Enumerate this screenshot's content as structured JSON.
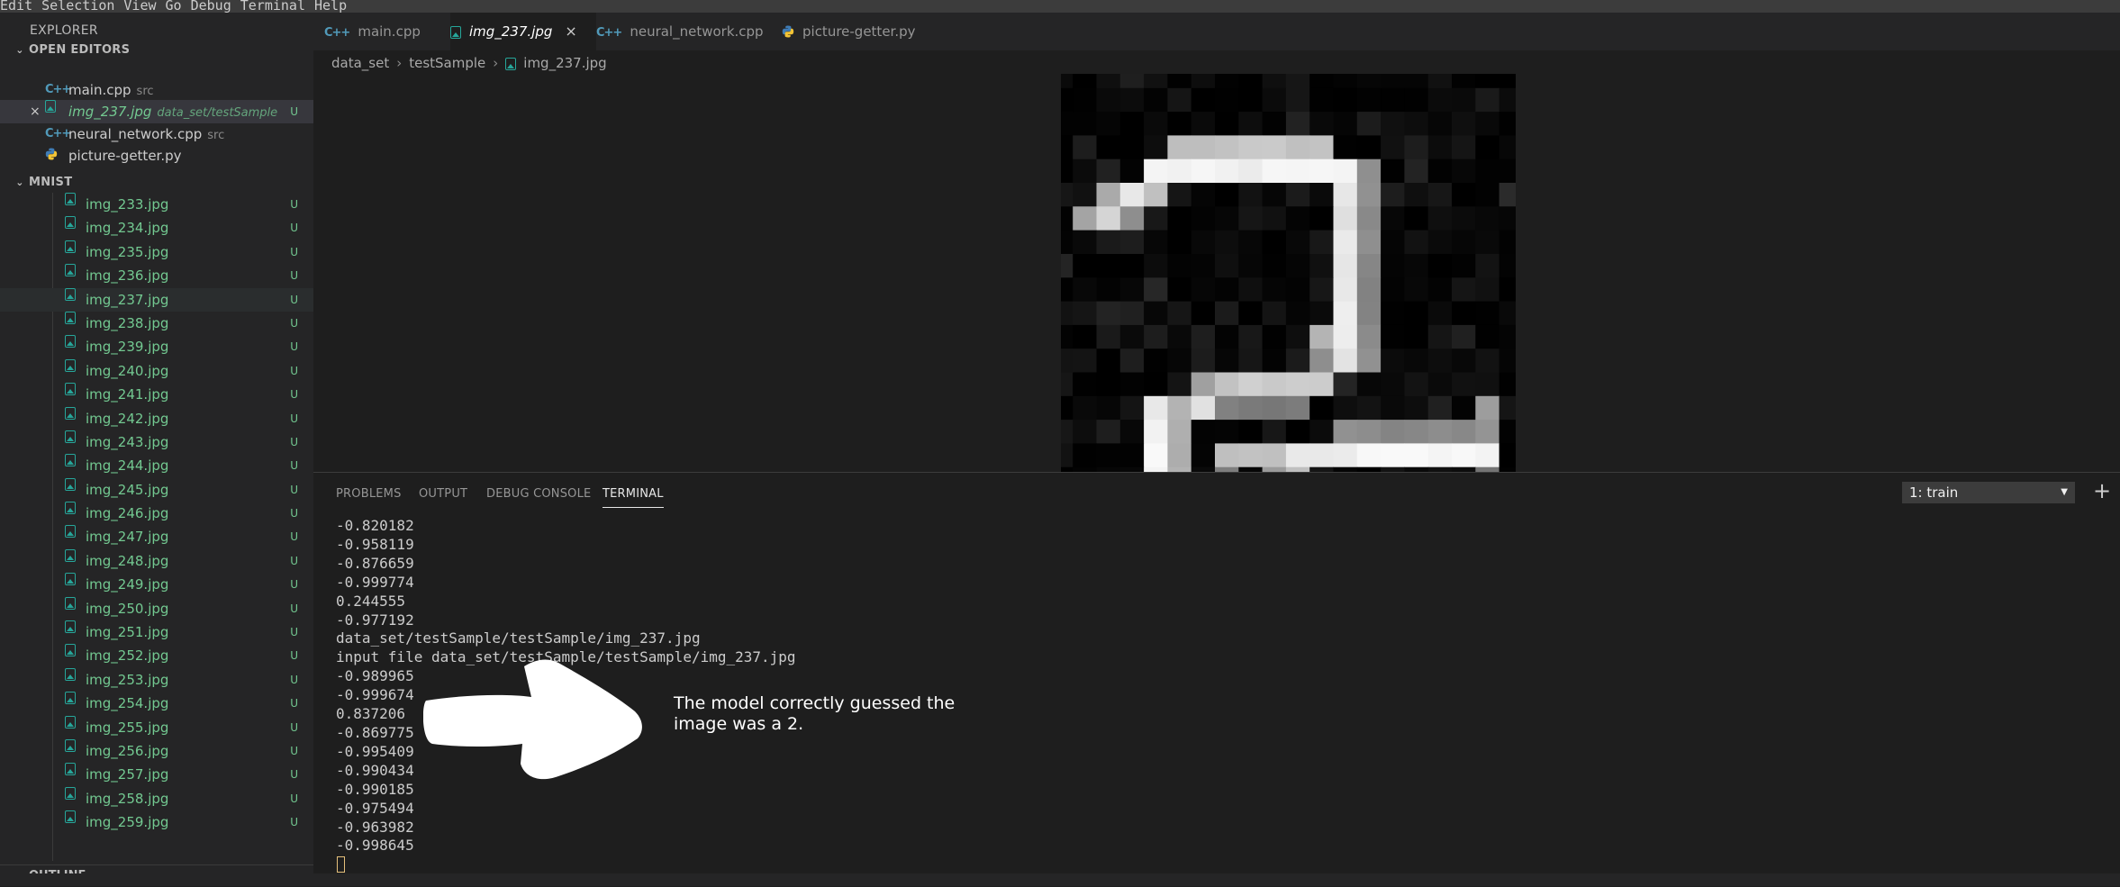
{
  "menubar": [
    "Edit",
    "Selection",
    "View",
    "Go",
    "Debug",
    "Terminal",
    "Help"
  ],
  "sidebar": {
    "title": "EXPLORER",
    "open_editors": {
      "header": "OPEN EDITORS",
      "items": [
        {
          "name": "main.cpp",
          "desc": "src",
          "type": "cpp"
        },
        {
          "name": "img_237.jpg",
          "desc": "data_set/testSample",
          "type": "img",
          "badge": "U",
          "close": "×"
        },
        {
          "name": "neural_network.cpp",
          "desc": "src",
          "type": "cpp"
        },
        {
          "name": "picture-getter.py",
          "desc": "",
          "type": "py"
        }
      ]
    },
    "folder": {
      "header": "MNIST",
      "files": [
        {
          "name": "img_233.jpg",
          "badge": "U"
        },
        {
          "name": "img_234.jpg",
          "badge": "U"
        },
        {
          "name": "img_235.jpg",
          "badge": "U"
        },
        {
          "name": "img_236.jpg",
          "badge": "U"
        },
        {
          "name": "img_237.jpg",
          "badge": "U"
        },
        {
          "name": "img_238.jpg",
          "badge": "U"
        },
        {
          "name": "img_239.jpg",
          "badge": "U"
        },
        {
          "name": "img_240.jpg",
          "badge": "U"
        },
        {
          "name": "img_241.jpg",
          "badge": "U"
        },
        {
          "name": "img_242.jpg",
          "badge": "U"
        },
        {
          "name": "img_243.jpg",
          "badge": "U"
        },
        {
          "name": "img_244.jpg",
          "badge": "U"
        },
        {
          "name": "img_245.jpg",
          "badge": "U"
        },
        {
          "name": "img_246.jpg",
          "badge": "U"
        },
        {
          "name": "img_247.jpg",
          "badge": "U"
        },
        {
          "name": "img_248.jpg",
          "badge": "U"
        },
        {
          "name": "img_249.jpg",
          "badge": "U"
        },
        {
          "name": "img_250.jpg",
          "badge": "U"
        },
        {
          "name": "img_251.jpg",
          "badge": "U"
        },
        {
          "name": "img_252.jpg",
          "badge": "U"
        },
        {
          "name": "img_253.jpg",
          "badge": "U"
        },
        {
          "name": "img_254.jpg",
          "badge": "U"
        },
        {
          "name": "img_255.jpg",
          "badge": "U"
        },
        {
          "name": "img_256.jpg",
          "badge": "U"
        },
        {
          "name": "img_257.jpg",
          "badge": "U"
        },
        {
          "name": "img_258.jpg",
          "badge": "U"
        },
        {
          "name": "img_259.jpg",
          "badge": "U"
        }
      ]
    },
    "outline_header": "OUTLINE"
  },
  "tabs": [
    {
      "label": "main.cpp",
      "type": "cpp"
    },
    {
      "label": "img_237.jpg",
      "type": "img",
      "active": true,
      "close": "×"
    },
    {
      "label": "neural_network.cpp",
      "type": "cpp"
    },
    {
      "label": "picture-getter.py",
      "type": "py"
    }
  ],
  "breadcrumb": [
    "data_set",
    "testSample",
    "img_237.jpg"
  ],
  "breadcrumb_sep": "›",
  "panel": {
    "tabs": [
      "PROBLEMS",
      "OUTPUT",
      "DEBUG CONSOLE",
      "TERMINAL"
    ],
    "active_tab": "TERMINAL",
    "terminal_select": "1: train",
    "add_label": "+",
    "terminal_lines": [
      "-0.820182",
      "-0.958119",
      "-0.876659",
      "-0.999774",
      "0.244555",
      "-0.977192",
      "data_set/testSample/testSample/img_237.jpg",
      "input file data_set/testSample/testSample/img_237.jpg",
      "-0.989965",
      "-0.999674",
      "0.837206",
      "-0.869775",
      "-0.995409",
      "-0.990434",
      "-0.990185",
      "-0.975494",
      "-0.963982",
      "-0.998645"
    ]
  },
  "annotation": {
    "text": "The model correctly guessed the image was a 2."
  },
  "colors": {
    "accent_git_untracked": "#73c991",
    "image_icon": "#26a69a",
    "cpp_icon": "#519aba"
  }
}
